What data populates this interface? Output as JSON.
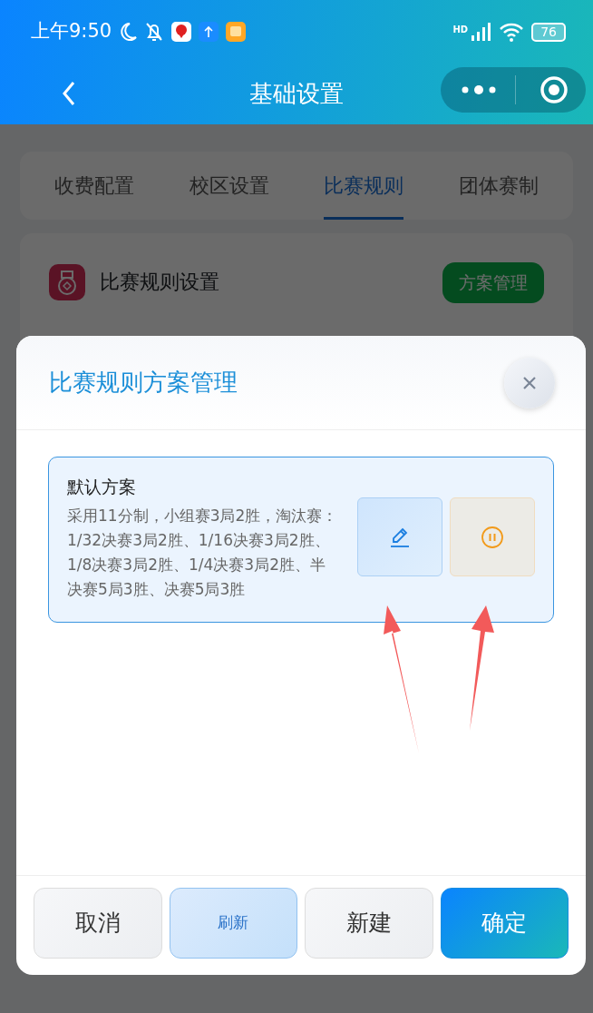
{
  "status_bar": {
    "time": "上午9:50",
    "network": "HD",
    "battery": "76"
  },
  "nav": {
    "title": "基础设置"
  },
  "tabs": [
    {
      "label": "收费配置",
      "selected": false
    },
    {
      "label": "校区设置",
      "selected": false
    },
    {
      "label": "比赛规则",
      "selected": true
    },
    {
      "label": "团体赛制",
      "selected": false
    }
  ],
  "section": {
    "title": "比赛规则设置",
    "button": "方案管理"
  },
  "modal": {
    "title": "比赛规则方案管理",
    "plans": [
      {
        "name": "默认方案",
        "description": "采用11分制，小组赛3局2胜，淘汰赛：1/32决赛3局2胜、1/16决赛3局2胜、1/8决赛3局2胜、1/4决赛3局2胜、半决赛5局3胜、决赛5局3胜",
        "selected": true
      }
    ],
    "buttons": [
      {
        "label": "取消",
        "kind": "secondary"
      },
      {
        "label": "刷新",
        "kind": "soft"
      },
      {
        "label": "新建",
        "kind": "secondary"
      },
      {
        "label": "确定",
        "kind": "primary"
      }
    ]
  }
}
